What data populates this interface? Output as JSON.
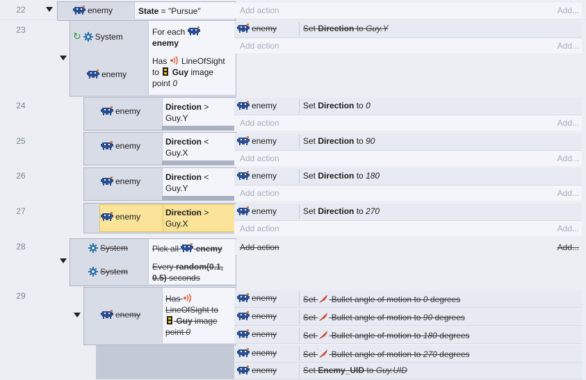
{
  "rows": [
    {
      "num": "22"
    },
    {
      "num": "23"
    },
    {
      "num": "24"
    },
    {
      "num": "25"
    },
    {
      "num": "26"
    },
    {
      "num": "27"
    },
    {
      "num": "28"
    },
    {
      "num": "29"
    }
  ],
  "labels": {
    "enemy": "enemy",
    "system": "System",
    "add_action": "Add action",
    "add_dots": "Add...",
    "to": "to",
    "set": "Set"
  },
  "e22": {
    "state_label": "State",
    "eq": " = ",
    "state_value": "\"Pursue\""
  },
  "e23": {
    "for_each": "For each",
    "for_each_obj": "enemy",
    "has": "Has",
    "los": "LineOfSight",
    "to": "to",
    "guy": "Guy",
    "image": "image",
    "point": "point",
    "point_val": "0",
    "act_set": "Set",
    "act_var": "Direction",
    "act_to": "to",
    "act_val": "Guy.Y"
  },
  "e24": {
    "cond_var": "Direction",
    "cond_op": ">",
    "cond_rhs": "Guy.Y",
    "act_var": "Direction",
    "act_val": "0"
  },
  "e25": {
    "cond_var": "Direction",
    "cond_op": "<",
    "cond_rhs": "Guy.X",
    "act_var": "Direction",
    "act_val": "90"
  },
  "e26": {
    "cond_var": "Direction",
    "cond_op": "<",
    "cond_rhs": "Guy.Y",
    "act_var": "Direction",
    "act_val": "180"
  },
  "e27": {
    "cond_var": "Direction",
    "cond_op": ">",
    "cond_rhs": "Guy.X",
    "act_var": "Direction",
    "act_val": "270"
  },
  "e28": {
    "pick_all": "Pick all",
    "pick_obj": "enemy",
    "every": "Every",
    "random": "random(0.1,",
    "random2": "0.5)",
    "seconds": "seconds"
  },
  "e29": {
    "has": "Has",
    "los": "LineOfSight to",
    "guy": "Guy",
    "image": "image",
    "point": "point",
    "point_val": "0",
    "bullet_text": "Bullet angle of motion to",
    "degrees": "degrees",
    "angles": [
      "0",
      "90",
      "180",
      "270"
    ],
    "last_var": "Enemy_UID",
    "last_val": "Guy.UID"
  },
  "colors": {
    "accent": "#2b6ea8",
    "highlight": "#fbe39a",
    "invader": "#2a4d8f"
  }
}
